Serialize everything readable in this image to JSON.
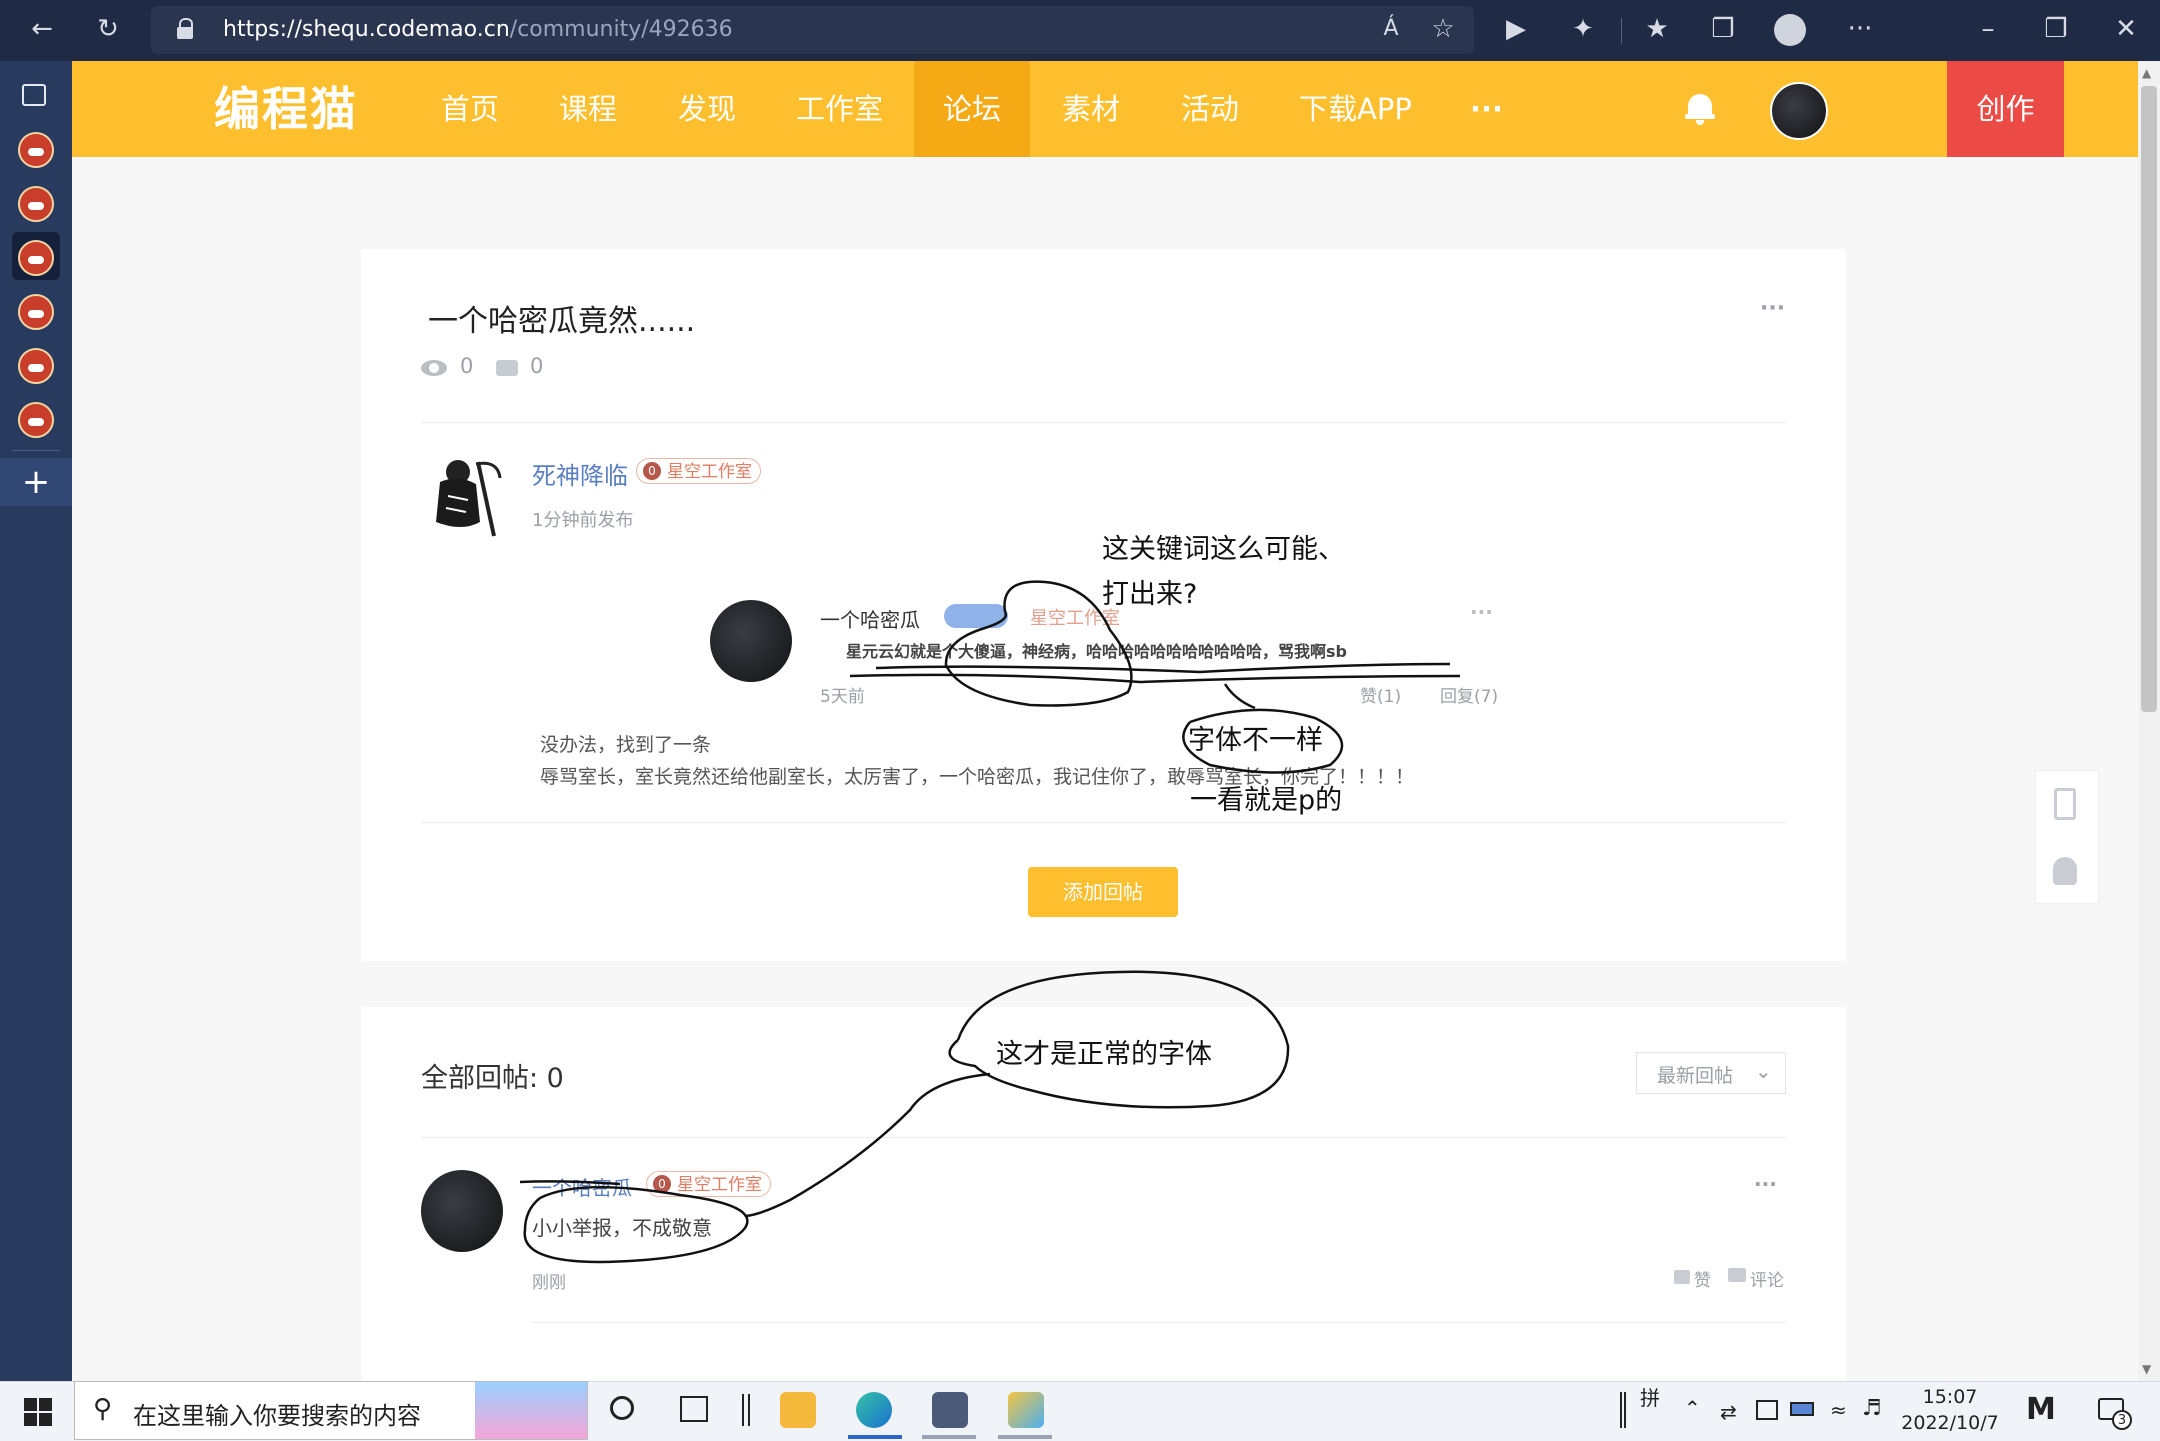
{
  "browser": {
    "url_host": "https://shequ.codemao.cn",
    "url_path": "/community/492636",
    "read_aloud": "Á",
    "more": "···"
  },
  "site": {
    "logo": "编程猫",
    "nav": [
      "首页",
      "课程",
      "发现",
      "工作室",
      "论坛",
      "素材",
      "活动",
      "下载APP"
    ],
    "nav_more": "···",
    "create": "创作"
  },
  "post": {
    "title": "一个哈密瓜竟然......",
    "views": "0",
    "comments": "0",
    "more": "···",
    "author": "死神降临",
    "studio": "星空工作室",
    "time": "1分钟前发布",
    "screenshot": {
      "name": "一个哈密瓜",
      "badge": "星空工作室",
      "content": "星元云幻就是个大傻逼，神经病，哈哈哈哈哈哈哈哈哈哈哈，骂我啊sb",
      "time": "5天前",
      "like": "赞(1)",
      "reply": "回复(7)",
      "more": "···"
    },
    "body_line1": "没办法，找到了一条",
    "body_line2": "辱骂室长，室长竟然还给他副室长，太厉害了，一个哈密瓜，我记住你了，敢辱骂室长，你完了！！！！",
    "add_reply": "添加回帖"
  },
  "replies": {
    "header": "全部回帖: 0",
    "sort": "最新回帖",
    "item": {
      "name": "一个哈密瓜",
      "studio": "星空工作室",
      "text": "小小举报，不成敬意",
      "time": "刚刚",
      "like": "赞",
      "comment": "评论",
      "more": "···"
    }
  },
  "annotations": {
    "a1_line1": "这关键词这么可能、",
    "a1_line2": "打出来?",
    "a2": "字体不一样",
    "a3": "一看就是p的",
    "a4": "这才是正常的字体"
  },
  "taskbar": {
    "search_placeholder": "在这里输入你要搜索的内容",
    "ime": "拼",
    "time": "15:07",
    "date": "2022/10/7",
    "notif_count": "3"
  },
  "colors": {
    "brand": "#fdbf2d",
    "brand_active": "#f5aa15",
    "create": "#ec4a45",
    "chrome": "#1f2b44",
    "tabstrip": "#283b5e"
  }
}
